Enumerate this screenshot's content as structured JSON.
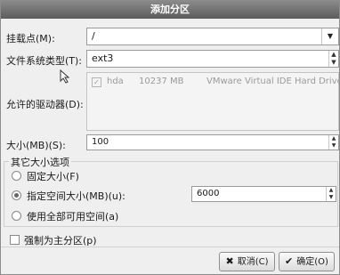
{
  "dialog": {
    "title": "添加分区"
  },
  "mount": {
    "label": "挂载点(M):",
    "value": "/"
  },
  "fstype": {
    "label": "文件系统类型(T):",
    "value": "ext3"
  },
  "drives": {
    "label": "允许的驱动器(D):",
    "rows": [
      {
        "name": "hda",
        "size": "10237 MB",
        "model": "VMware Virtual IDE Hard Drive",
        "checked": true
      }
    ]
  },
  "size": {
    "label": "大小(MB)(S):",
    "value": "100"
  },
  "other": {
    "legend": "其它大小选项",
    "fixed_label": "固定大小(F)",
    "maxsize_label": "指定空间大小(MB)(u):",
    "maxsize_value": "6000",
    "fill_label": "使用全部可用空间(a)",
    "selected": "maxsize"
  },
  "primary": {
    "label": "强制为主分区(p)",
    "checked": false
  },
  "buttons": {
    "cancel": "取消(C)",
    "ok": "确定(O)"
  },
  "icons": {
    "dropdown": "▼",
    "spin": "▲▼",
    "cancel": "✖",
    "ok": "✔"
  }
}
